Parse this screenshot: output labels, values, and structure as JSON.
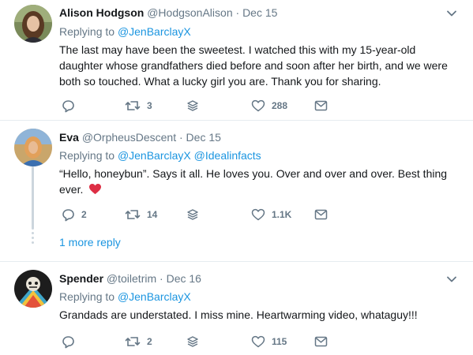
{
  "tweets": [
    {
      "name": "Alison Hodgson",
      "handle": "@HodgsonAlison",
      "date": "Dec 15",
      "replying_label": "Replying to",
      "mentions": [
        "@JenBarclayX"
      ],
      "text": "The last may have been the sweetest. I watched this with my 15-year-old daughter whose grandfathers died before and soon after her birth, and we were both so touched. What a lucky girl you are. Thank you for sharing.",
      "replies": "",
      "retweets": "3",
      "likes": "288"
    },
    {
      "name": "Eva",
      "handle": "@OrpheusDescent",
      "date": "Dec 15",
      "replying_label": "Replying to",
      "mentions": [
        "@JenBarclayX",
        "@Idealinfacts"
      ],
      "text": "“Hello, honeybun”. Says it all. He loves you. Over and over and over. Best thing ever.",
      "replies": "2",
      "retweets": "14",
      "likes": "1.1K",
      "more_replies": "1 more reply"
    },
    {
      "name": "Spender",
      "handle": "@toiletrim",
      "date": "Dec 16",
      "replying_label": "Replying to",
      "mentions": [
        "@JenBarclayX"
      ],
      "text": "Grandads are understated. I miss mine. Heartwarming video, whataguy!!!",
      "replies": "",
      "retweets": "2",
      "likes": "115"
    }
  ],
  "separator": "·",
  "icons": {
    "reply": "reply-icon",
    "retweet": "retweet-icon",
    "stack": "layers-icon",
    "like": "heart-icon",
    "dm": "envelope-icon",
    "caret": "chevron-down-icon",
    "emoji": "red-heart-emoji"
  },
  "colors": {
    "link": "#1b95e0",
    "muted": "#657786",
    "text": "#14171a",
    "divider": "#e6ecf0",
    "heart_emoji": "#dd2e44"
  }
}
